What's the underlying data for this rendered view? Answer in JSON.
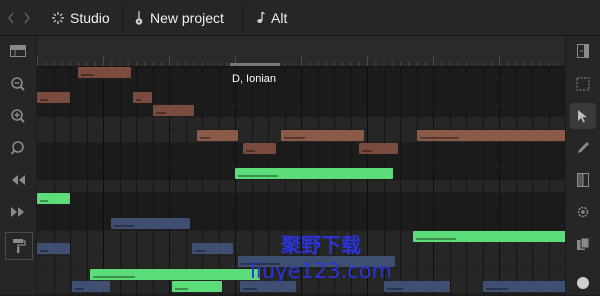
{
  "topbar": {
    "items": [
      {
        "label": "Studio",
        "icon": "studio-sparkle-icon"
      },
      {
        "label": "New project",
        "icon": "guitar-icon"
      },
      {
        "label": "Alt",
        "icon": "music-note-icon"
      }
    ]
  },
  "editor": {
    "scale_label": "D, Ionian"
  },
  "left_tools": [
    "panel-toggle-icon",
    "zoom-out-icon",
    "zoom-in-icon",
    "zoom-fit-icon",
    "rewind-icon",
    "fast-forward-icon",
    "paint-roller-icon"
  ],
  "right_tools": [
    "sidebar-collapse-icon",
    "select-box-icon",
    "pointer-icon",
    "pencil-icon",
    "split-icon",
    "gear-icon",
    "copy-icon",
    "record-icon"
  ],
  "notes": [
    {
      "row": 0,
      "start": 2.5,
      "len": 3.2,
      "color": "#7a4b3e"
    },
    {
      "row": 2,
      "start": 0,
      "len": 2,
      "color": "#7a4b3e"
    },
    {
      "row": 2,
      "start": 5.8,
      "len": 1.2,
      "color": "#7a4b3e"
    },
    {
      "row": 3,
      "start": 7,
      "len": 2.5,
      "color": "#7a4b3e"
    },
    {
      "row": 5,
      "start": 9.7,
      "len": 2.5,
      "color": "#8c5a48"
    },
    {
      "row": 5,
      "start": 14.8,
      "len": 5,
      "color": "#8c5a48"
    },
    {
      "row": 5,
      "start": 23,
      "len": 9.5,
      "color": "#8c5a48"
    },
    {
      "row": 6,
      "start": 12.5,
      "len": 2,
      "color": "#7a4b3e"
    },
    {
      "row": 6,
      "start": 19.5,
      "len": 2.4,
      "color": "#7a4b3e"
    },
    {
      "row": 8,
      "start": 12,
      "len": 9.6,
      "color": "#5ddc7a"
    },
    {
      "row": 10,
      "start": 0,
      "len": 2,
      "color": "#5ddc7a"
    },
    {
      "row": 12,
      "start": 4.5,
      "len": 4.8,
      "color": "#3f4f72"
    },
    {
      "row": 13,
      "start": 22.8,
      "len": 9.7,
      "color": "#5ddc7a"
    },
    {
      "row": 14,
      "start": 0,
      "len": 2,
      "color": "#3f4f72"
    },
    {
      "row": 14,
      "start": 9.4,
      "len": 2.5,
      "color": "#3f4f72"
    },
    {
      "row": 15,
      "start": 12.2,
      "len": 9.5,
      "color": "#3f4f72"
    },
    {
      "row": 16,
      "start": 3.2,
      "len": 10.3,
      "color": "#5ddc7a"
    },
    {
      "row": 17,
      "start": 2.1,
      "len": 2.3,
      "color": "#3f4f72"
    },
    {
      "row": 17,
      "start": 8.2,
      "len": 3,
      "color": "#5ddc7a"
    },
    {
      "row": 17,
      "start": 12.3,
      "len": 3.4,
      "color": "#3f4f72"
    },
    {
      "row": 17,
      "start": 21,
      "len": 4,
      "color": "#3f4f72"
    },
    {
      "row": 17,
      "start": 27,
      "len": 5.5,
      "color": "#3f4f72"
    }
  ],
  "light_rows": [
    4,
    5,
    9,
    13,
    14,
    15,
    16,
    17
  ],
  "watermark": {
    "line1": "聚野下载",
    "line2": "liuye123.com"
  }
}
